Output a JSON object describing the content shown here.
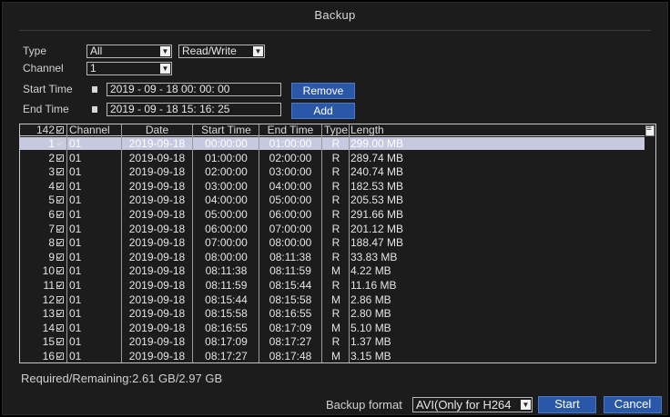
{
  "title": "Backup",
  "filters": {
    "type_label": "Type",
    "type_value": "All",
    "rw_value": "Read/Write",
    "channel_label": "Channel",
    "channel_value": "1",
    "start_label": "Start Time",
    "start_value": "2019 - 09 - 18  00: 00: 00",
    "end_label": "End Time",
    "end_value": "2019 - 09 - 18  15: 16: 25",
    "remove_label": "Remove",
    "add_label": "Add"
  },
  "table": {
    "headers": {
      "count": "142",
      "channel": "Channel",
      "date": "Date",
      "start": "Start Time",
      "end": "End Time",
      "type": "Type",
      "length": "Length"
    },
    "rows": [
      {
        "num": "1",
        "ch": "01",
        "date": "2019-09-18",
        "start": "00:00:00",
        "end": "01:00:00",
        "type": "R",
        "len": "299.00 MB"
      },
      {
        "num": "2",
        "ch": "01",
        "date": "2019-09-18",
        "start": "01:00:00",
        "end": "02:00:00",
        "type": "R",
        "len": "289.74 MB"
      },
      {
        "num": "3",
        "ch": "01",
        "date": "2019-09-18",
        "start": "02:00:00",
        "end": "03:00:00",
        "type": "R",
        "len": "240.74 MB"
      },
      {
        "num": "4",
        "ch": "01",
        "date": "2019-09-18",
        "start": "03:00:00",
        "end": "04:00:00",
        "type": "R",
        "len": "182.53 MB"
      },
      {
        "num": "5",
        "ch": "01",
        "date": "2019-09-18",
        "start": "04:00:00",
        "end": "05:00:00",
        "type": "R",
        "len": "205.53 MB"
      },
      {
        "num": "6",
        "ch": "01",
        "date": "2019-09-18",
        "start": "05:00:00",
        "end": "06:00:00",
        "type": "R",
        "len": "291.66 MB"
      },
      {
        "num": "7",
        "ch": "01",
        "date": "2019-09-18",
        "start": "06:00:00",
        "end": "07:00:00",
        "type": "R",
        "len": "201.12 MB"
      },
      {
        "num": "8",
        "ch": "01",
        "date": "2019-09-18",
        "start": "07:00:00",
        "end": "08:00:00",
        "type": "R",
        "len": "188.47 MB"
      },
      {
        "num": "9",
        "ch": "01",
        "date": "2019-09-18",
        "start": "08:00:00",
        "end": "08:11:38",
        "type": "R",
        "len": "33.83 MB"
      },
      {
        "num": "10",
        "ch": "01",
        "date": "2019-09-18",
        "start": "08:11:38",
        "end": "08:11:59",
        "type": "M",
        "len": "4.22 MB"
      },
      {
        "num": "11",
        "ch": "01",
        "date": "2019-09-18",
        "start": "08:11:59",
        "end": "08:15:44",
        "type": "R",
        "len": "11.16 MB"
      },
      {
        "num": "12",
        "ch": "01",
        "date": "2019-09-18",
        "start": "08:15:44",
        "end": "08:15:58",
        "type": "M",
        "len": "2.86 MB"
      },
      {
        "num": "13",
        "ch": "01",
        "date": "2019-09-18",
        "start": "08:15:58",
        "end": "08:16:55",
        "type": "R",
        "len": "2.80 MB"
      },
      {
        "num": "14",
        "ch": "01",
        "date": "2019-09-18",
        "start": "08:16:55",
        "end": "08:17:09",
        "type": "M",
        "len": "5.10 MB"
      },
      {
        "num": "15",
        "ch": "01",
        "date": "2019-09-18",
        "start": "08:17:09",
        "end": "08:17:27",
        "type": "R",
        "len": "1.37 MB"
      },
      {
        "num": "16",
        "ch": "01",
        "date": "2019-09-18",
        "start": "08:17:27",
        "end": "08:17:48",
        "type": "M",
        "len": "3.15 MB"
      }
    ]
  },
  "footer": {
    "required": "Required/Remaining:2.61 GB/2.97 GB",
    "backup_format_label": "Backup format",
    "backup_format_value": "AVI(Only for H264",
    "start_label": "Start",
    "cancel_label": "Cancel"
  },
  "colors": {
    "selection": "#c6c9df",
    "button": "#2a57a8",
    "background": "#1c1c1c"
  }
}
